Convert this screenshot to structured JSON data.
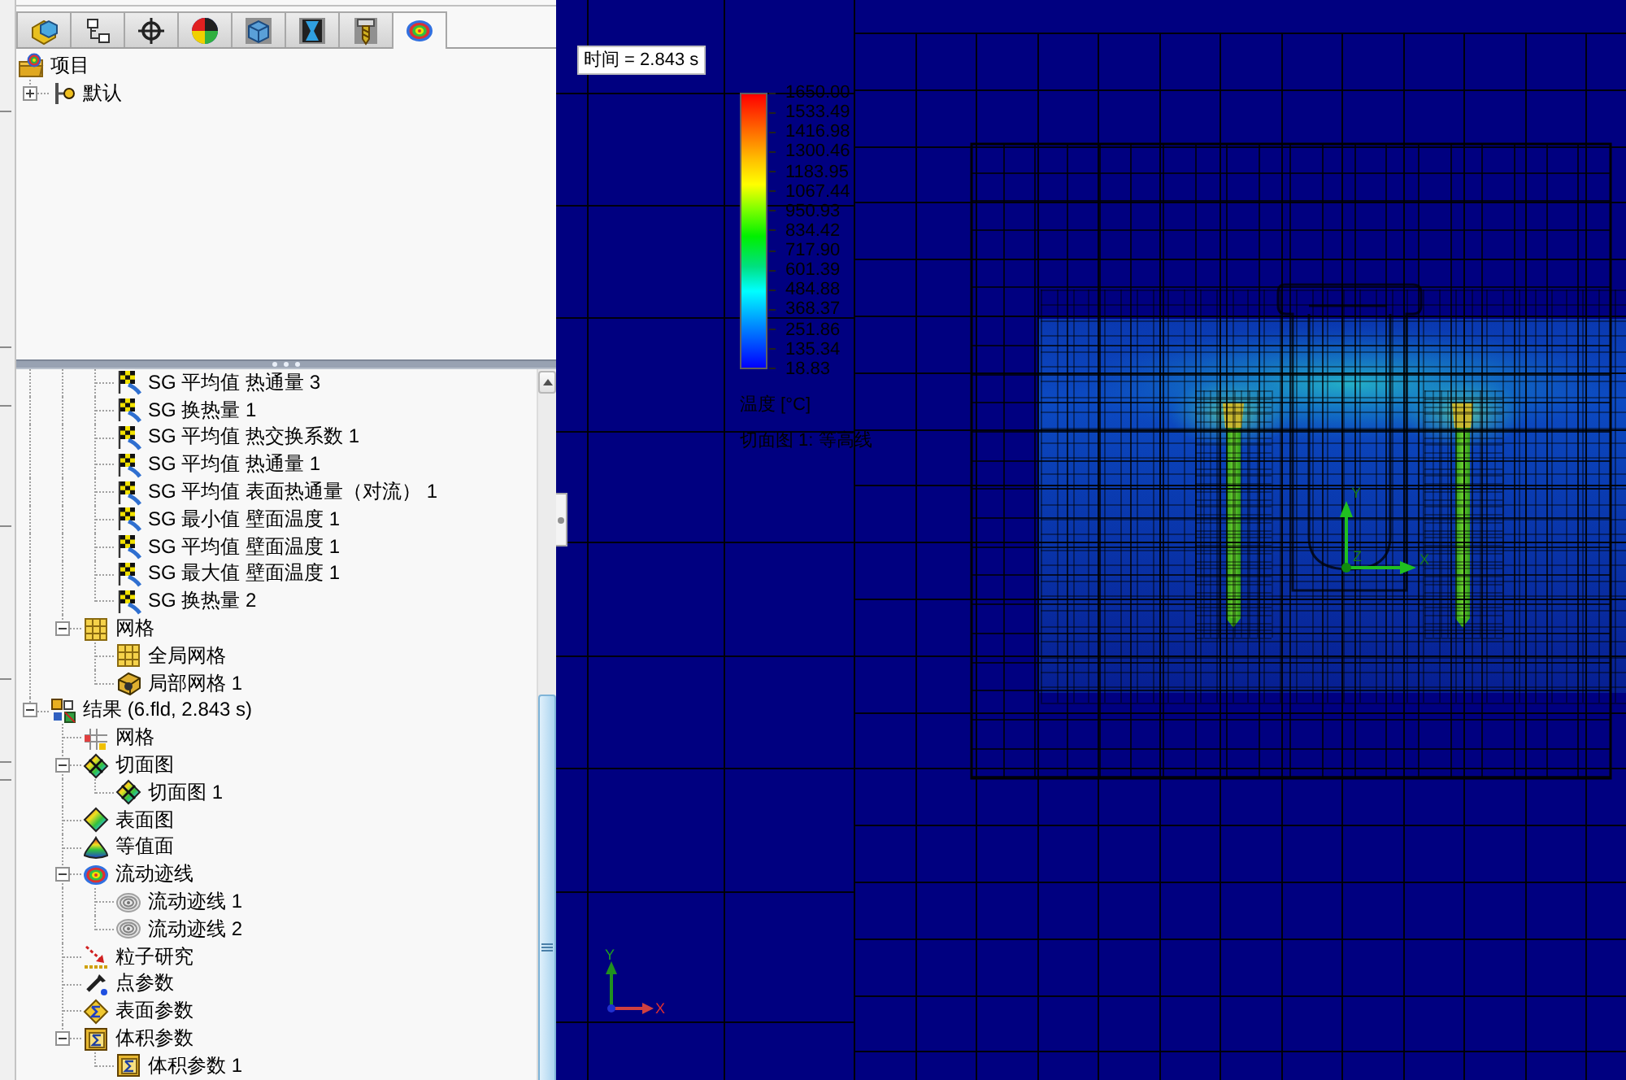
{
  "tabs": [
    {
      "selected": false
    },
    {
      "selected": false
    },
    {
      "selected": false
    },
    {
      "selected": false
    },
    {
      "selected": false
    },
    {
      "selected": false
    },
    {
      "selected": false
    },
    {
      "selected": true
    }
  ],
  "project_tree": {
    "label": "项目",
    "kind": "project",
    "children": [
      {
        "label": "默认",
        "kind": "config",
        "expanded": false
      }
    ]
  },
  "feature_tree": {
    "items": [
      {
        "children": [
          {
            "children": [
              {
                "label": "SG 平均值 热通量 3",
                "kind": "goal"
              },
              {
                "label": "SG 换热量 1",
                "kind": "goal"
              },
              {
                "label": "SG 平均值 热交换系数 1",
                "kind": "goal"
              },
              {
                "label": "SG 平均值 热通量 1",
                "kind": "goal"
              },
              {
                "label": "SG 平均值 表面热通量（对流） 1",
                "kind": "goal"
              },
              {
                "label": "SG 最小值 壁面温度 1",
                "kind": "goal"
              },
              {
                "label": "SG 平均值 壁面温度 1",
                "kind": "goal"
              },
              {
                "label": "SG 最大值 壁面温度 1",
                "kind": "goal"
              },
              {
                "label": "SG 换热量 2",
                "kind": "goal"
              }
            ]
          },
          {
            "label": "网格",
            "kind": "mesh",
            "expanded": true,
            "children": [
              {
                "label": "全局网格",
                "kind": "mesh"
              },
              {
                "label": "局部网格 1",
                "kind": "localmesh"
              }
            ]
          }
        ]
      },
      {
        "label": "结果 (6.fld, 2.843 s)",
        "kind": "results",
        "expanded": true,
        "children": [
          {
            "label": "网格",
            "kind": "resultmesh"
          },
          {
            "label": "切面图",
            "kind": "cutplot",
            "expanded": true,
            "children": [
              {
                "label": "切面图 1",
                "kind": "cutplot"
              }
            ]
          },
          {
            "label": "表面图",
            "kind": "surfaceplot"
          },
          {
            "label": "等值面",
            "kind": "isosurface"
          },
          {
            "label": "流动迹线",
            "kind": "flowtraj",
            "expanded": true,
            "children": [
              {
                "label": "流动迹线 1",
                "kind": "trajectory"
              },
              {
                "label": "流动迹线 2",
                "kind": "trajectory"
              }
            ]
          },
          {
            "label": "粒子研究",
            "kind": "particle"
          },
          {
            "label": "点参数",
            "kind": "pointparam"
          },
          {
            "label": "表面参数",
            "kind": "surfaceparam"
          },
          {
            "label": "体积参数",
            "kind": "volumeparam",
            "expanded": true,
            "children": [
              {
                "label": "体积参数 1",
                "kind": "volumeparam"
              }
            ]
          }
        ]
      }
    ]
  },
  "viewport": {
    "time_label": "时间 = 2.843 s",
    "legend": {
      "ticks": [
        "1650.00",
        "1533.49",
        "1416.98",
        "1300.46",
        "1183.95",
        "1067.44",
        "950.93",
        "834.42",
        "717.90",
        "601.39",
        "484.88",
        "368.37",
        "251.86",
        "135.34",
        "18.83"
      ],
      "title": "温度 [°C]",
      "caption": "切面图 1: 等高线"
    },
    "model_axes": {
      "y": "Y",
      "z": "Z",
      "x": "X"
    },
    "view_axes": {
      "y": "Y",
      "x": "X"
    }
  }
}
